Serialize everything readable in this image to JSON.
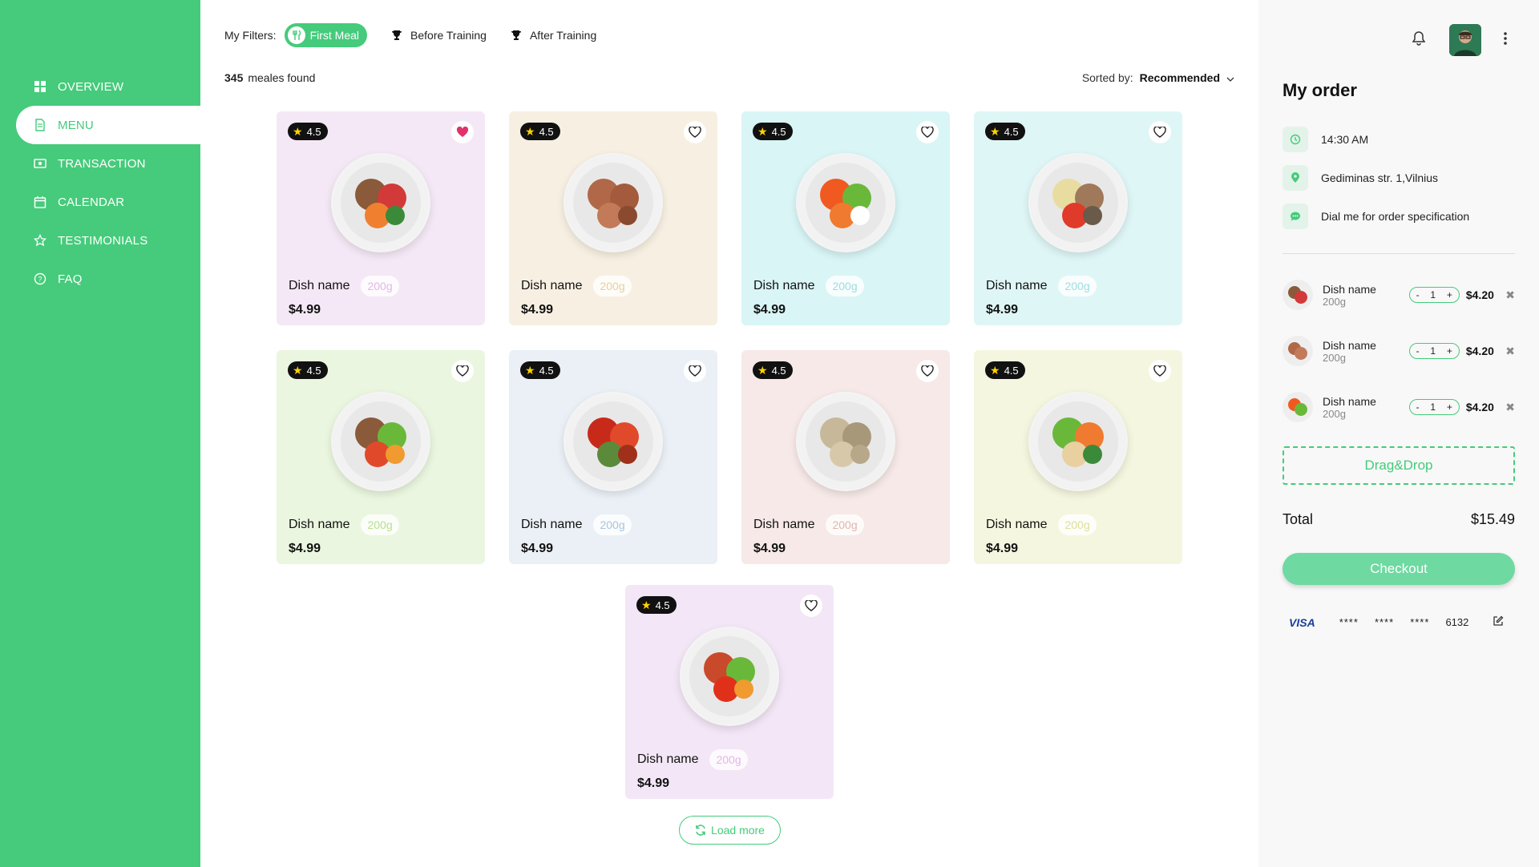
{
  "sidebar": {
    "items": [
      {
        "label": "OVERVIEW",
        "icon": "grid-icon",
        "active": false
      },
      {
        "label": "MENU",
        "icon": "document-icon",
        "active": true
      },
      {
        "label": "TRANSACTION",
        "icon": "cash-icon",
        "active": false
      },
      {
        "label": "CALENDAR",
        "icon": "calendar-icon",
        "active": false
      },
      {
        "label": "TESTIMONIALS",
        "icon": "star-icon",
        "active": false
      },
      {
        "label": "FAQ",
        "icon": "question-icon",
        "active": false
      }
    ]
  },
  "filters": {
    "label": "My Filters:",
    "items": [
      {
        "label": "First Meal",
        "active": true
      },
      {
        "label": "Before Training",
        "active": false
      },
      {
        "label": "After Training",
        "active": false
      }
    ]
  },
  "results": {
    "count": "345",
    "label": "meales found"
  },
  "sort": {
    "label": "Sorted by:",
    "value": "Recommended"
  },
  "dishes": [
    {
      "rating": "4.5",
      "name": "Dish name",
      "weight": "200g",
      "price": "$4.99",
      "liked": true,
      "bg": "#f5e8f6",
      "weight_color": "#e3b6e6"
    },
    {
      "rating": "4.5",
      "name": "Dish name",
      "weight": "200g",
      "price": "$4.99",
      "liked": false,
      "bg": "#f7f0e2",
      "weight_color": "#e9cf9a"
    },
    {
      "rating": "4.5",
      "name": "Dish name",
      "weight": "200g",
      "price": "$4.99",
      "liked": false,
      "bg": "#d9f5f6",
      "weight_color": "#9ddde2"
    },
    {
      "rating": "4.5",
      "name": "Dish name",
      "weight": "200g",
      "price": "$4.99",
      "liked": false,
      "bg": "#dff6f6",
      "weight_color": "#9ddde2"
    },
    {
      "rating": "4.5",
      "name": "Dish name",
      "weight": "200g",
      "price": "$4.99",
      "liked": false,
      "bg": "#eaf6df",
      "weight_color": "#b8e08e"
    },
    {
      "rating": "4.5",
      "name": "Dish name",
      "weight": "200g",
      "price": "$4.99",
      "liked": false,
      "bg": "#eaf0f6",
      "weight_color": "#a9c4de"
    },
    {
      "rating": "4.5",
      "name": "Dish name",
      "weight": "200g",
      "price": "$4.99",
      "liked": false,
      "bg": "#f6e9e7",
      "weight_color": "#e2b4ae"
    },
    {
      "rating": "4.5",
      "name": "Dish name",
      "weight": "200g",
      "price": "$4.99",
      "liked": false,
      "bg": "#f5f6df",
      "weight_color": "#dde09a"
    },
    {
      "rating": "4.5",
      "name": "Dish name",
      "weight": "200g",
      "price": "$4.99",
      "liked": false,
      "bg": "#f3e6f6",
      "weight_color": "#e3b6e6"
    }
  ],
  "load_more": "Load more",
  "order": {
    "title": "My order",
    "time": "14:30 AM",
    "address": "Gediminas str. 1,Vilnius",
    "note": "Dial me for order specification",
    "items": [
      {
        "name": "Dish name",
        "weight": "200g",
        "qty": "1",
        "price": "$4.20"
      },
      {
        "name": "Dish name",
        "weight": "200g",
        "qty": "1",
        "price": "$4.20"
      },
      {
        "name": "Dish name",
        "weight": "200g",
        "qty": "1",
        "price": "$4.20"
      }
    ],
    "dragdrop": "Drag&Drop",
    "total_label": "Total",
    "total_value": "$15.49",
    "checkout": "Checkout",
    "card": {
      "brand": "VISA",
      "mask1": "****",
      "mask2": "****",
      "mask3": "****",
      "last4": "6132"
    }
  },
  "colors": {
    "accent": "#45cb7b",
    "favorite": "#e0336b",
    "rating_star": "#ffd400"
  }
}
